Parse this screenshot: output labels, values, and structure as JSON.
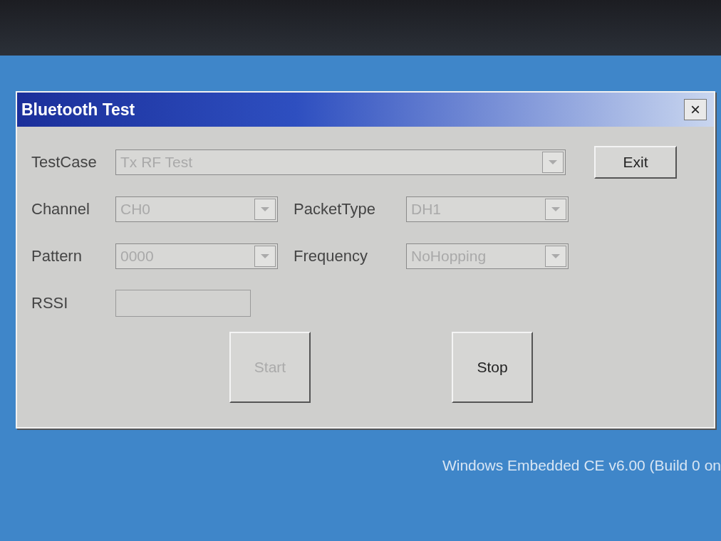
{
  "window": {
    "title": "Bluetooth Test",
    "close": "×"
  },
  "rows": [
    {
      "fields": [
        {
          "label": "TestCase",
          "kind": "combo",
          "value": "Tx RF Test",
          "disabled": true
        }
      ],
      "button": {
        "label": "Exit",
        "disabled": false
      }
    },
    {
      "fields": [
        {
          "label": "Channel",
          "kind": "combo",
          "value": "CH0",
          "disabled": true
        },
        {
          "label": "PacketType",
          "kind": "combo",
          "value": "DH1",
          "disabled": true
        }
      ]
    },
    {
      "fields": [
        {
          "label": "Pattern",
          "kind": "combo",
          "value": "0000",
          "disabled": true
        },
        {
          "label": "Frequency",
          "kind": "combo",
          "value": "NoHopping",
          "disabled": true
        }
      ]
    },
    {
      "fields": [
        {
          "label": "RSSI",
          "kind": "text",
          "disabled": true
        }
      ]
    }
  ],
  "actions": [
    {
      "label": "Start",
      "disabled": true
    },
    {
      "label": "Stop",
      "disabled": false
    }
  ],
  "desktop": {
    "version_text": "Windows Embedded CE v6.00 (Build 0 on"
  }
}
